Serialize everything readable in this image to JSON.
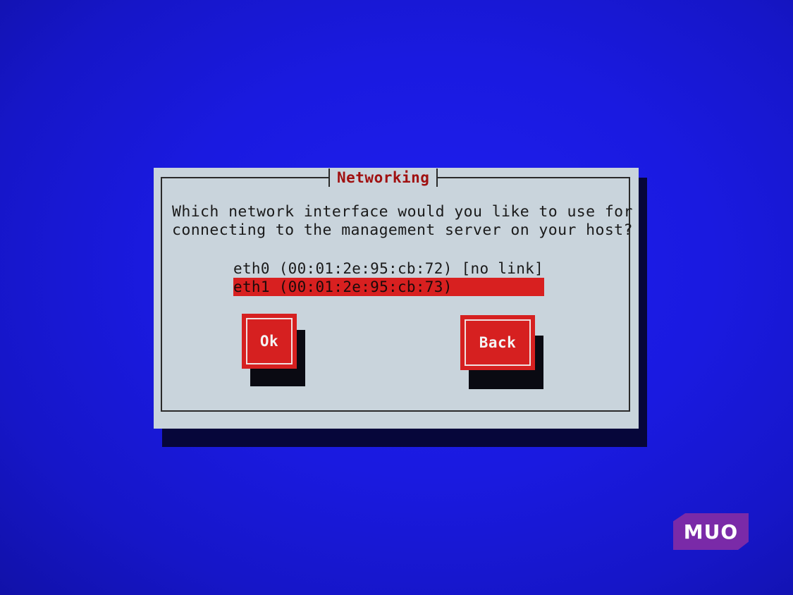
{
  "dialog": {
    "title": "Networking",
    "prompt_line1": "Which network interface would you like to use for",
    "prompt_line2": "connecting to the management server on your host?",
    "interfaces": [
      {
        "label": "eth0 (00:01:2e:95:cb:72) [no link]",
        "selected": false
      },
      {
        "label": "eth1 (00:01:2e:95:cb:73)",
        "selected": true
      }
    ],
    "buttons": {
      "ok_label": "Ok",
      "back_label": "Back"
    }
  },
  "watermark": {
    "text": "MUO"
  },
  "colors": {
    "screen_background": "#1a1ae0",
    "dialog_background": "#c9d4dc",
    "title_text": "#a01010",
    "selection_background": "#d82020",
    "button_background": "#d62020",
    "watermark_background": "#7a2aa8"
  }
}
